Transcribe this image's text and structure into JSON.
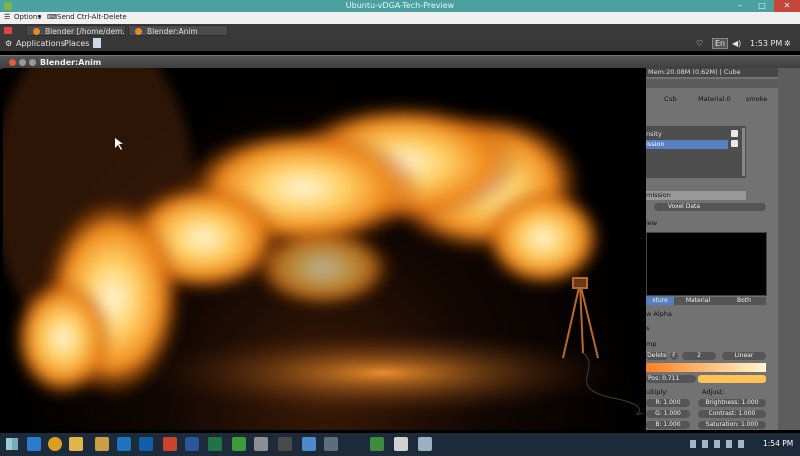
{
  "host_window": {
    "title": "Ubuntu-vDGA-Tech-Preview"
  },
  "vnc_toolbar": {
    "options_label": "Options",
    "send_cad_label": "Send Ctrl-Alt-Delete"
  },
  "ubuntu_tasks": [
    {
      "label": "Blender [/home/dem..."
    },
    {
      "label": "Blender:Anim"
    }
  ],
  "ubuntu_panel": {
    "applications": "Applications",
    "places": "Places",
    "keyboard": "En",
    "clock": "1:53 PM"
  },
  "blender_window": {
    "title": "Blender:Anim"
  },
  "properties": {
    "info": "Mem:20.08M (0.62M) | Cube",
    "breadcrumb_1": "Cub",
    "breadcrumb_2": "Material.0",
    "breadcrumb_3": "smoke",
    "slot_density": "nsity",
    "slot_emission": "ission",
    "texture_name": "mission",
    "texture_type": "Voxel Data",
    "preview_label": "iew",
    "tabs": [
      "xture",
      "Material",
      "Both"
    ],
    "alpha_label": "w Alpha",
    "section_s": "s",
    "ramp_label": "mp",
    "delete_label": "Delete",
    "ramp_index": "2",
    "interpolation": "Linear",
    "pos_label": "Pos: 0.711",
    "multiply_label": "ultiply:",
    "adjust_label": "Adjust:",
    "r_label": "R: 1.000",
    "g_label": "G: 1.000",
    "b_label": "B: 1.000",
    "brightness_label": "Brightness: 1.000",
    "contrast_label": "Contrast: 1.000",
    "saturation_label": "Saturation: 1.000"
  },
  "windows_taskbar": {
    "clock": "1:54 PM"
  },
  "colors": {
    "host_title": "#4aa1a0",
    "blender_panel": "#727272",
    "selection": "#5680c2",
    "fire": "#ffb030"
  }
}
